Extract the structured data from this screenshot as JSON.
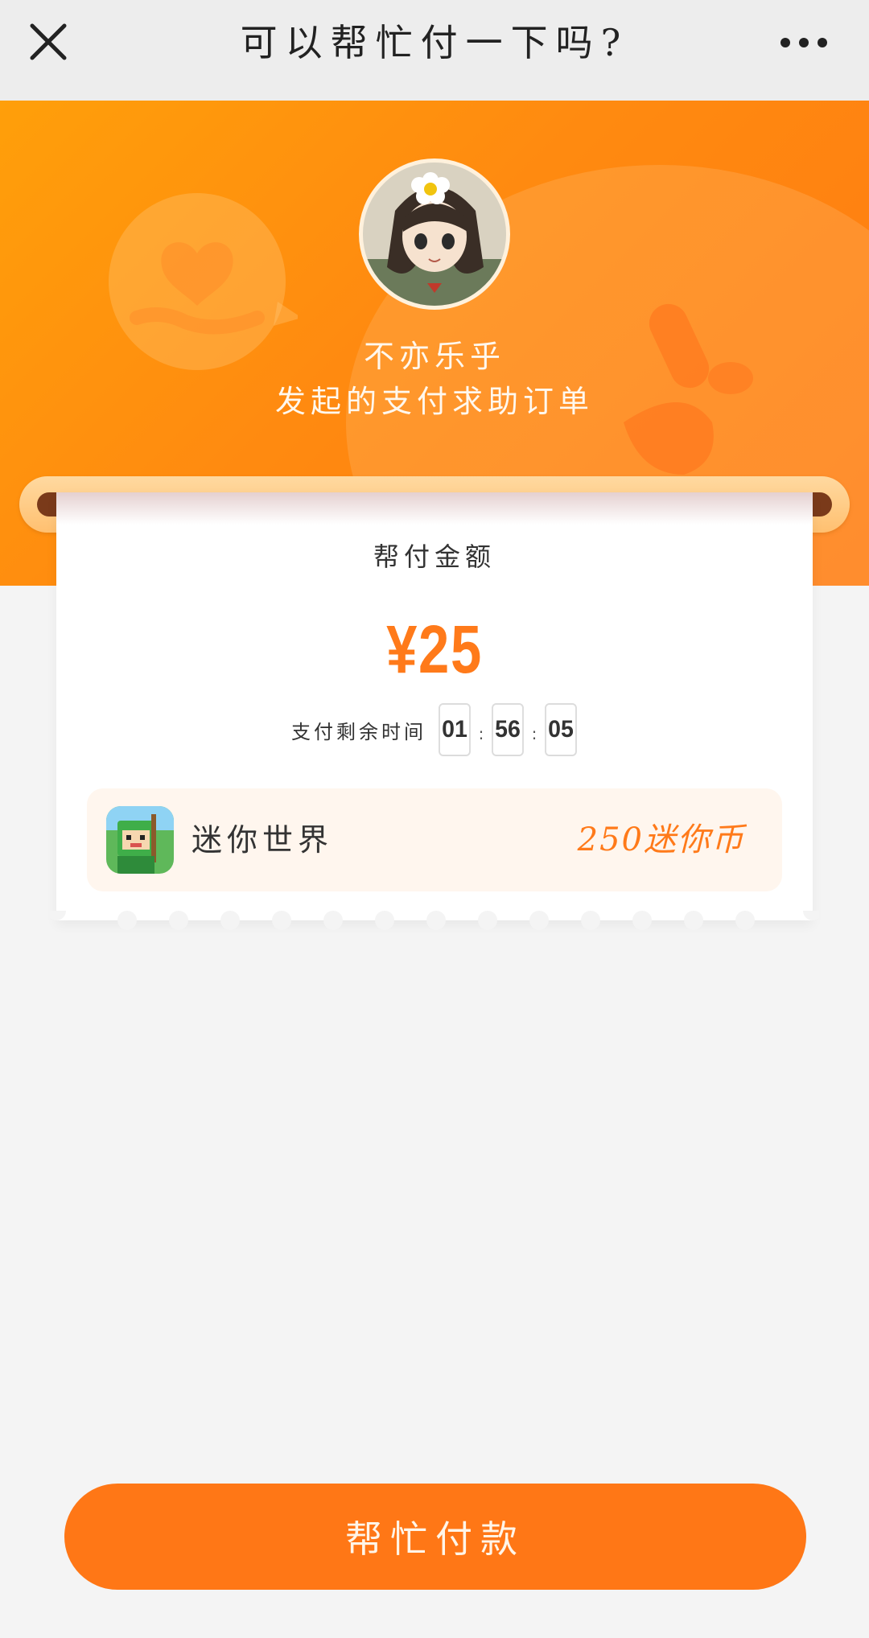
{
  "navbar": {
    "title": "可以帮忙付一下吗?",
    "close_icon": "close-icon",
    "more_icon": "more-dots-icon"
  },
  "hero": {
    "user_name": "不亦乐乎",
    "subtitle": "发起的支付求助订单",
    "background_color": "#ff8a10"
  },
  "ticket": {
    "label": "帮付金额",
    "amount": "¥25",
    "timer": {
      "label": "支付剩余时间",
      "hours": "01",
      "minutes": "56",
      "seconds": "05",
      "separator": ":"
    },
    "product": {
      "name": "迷你世界",
      "price": "250迷你币"
    }
  },
  "actions": {
    "pay_label": "帮忙付款"
  },
  "colors": {
    "accent": "#ff7a1a",
    "button": "#ff7716",
    "page_background": "#f4f4f4"
  }
}
